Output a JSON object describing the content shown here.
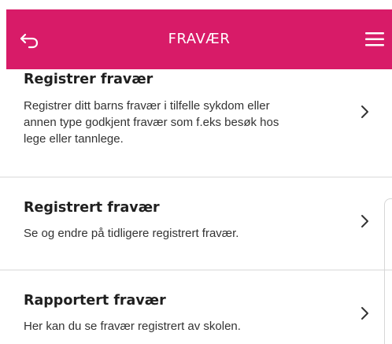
{
  "header": {
    "title": "FRAVÆR",
    "background_color": "#d81b68",
    "back_icon": "back-arrow-icon",
    "menu_icon": "hamburger-menu-icon"
  },
  "menu_items": [
    {
      "title": "Registrer fravær",
      "description_lines": [
        "Registrer ditt barns fravær i tilfelle sykdom eller",
        "annen type godkjent fravær som f.eks besøk hos",
        "lege eller tannlege."
      ],
      "icon": "chevron-right-icon"
    },
    {
      "title": "Registrert fravær",
      "description_lines": [
        "Se og endre på tidligere registrert fravær."
      ],
      "icon": "chevron-right-icon"
    },
    {
      "title": "Rapportert fravær",
      "description_lines": [
        "Her kan du se fravær registrert av skolen."
      ],
      "icon": "chevron-right-icon"
    }
  ]
}
